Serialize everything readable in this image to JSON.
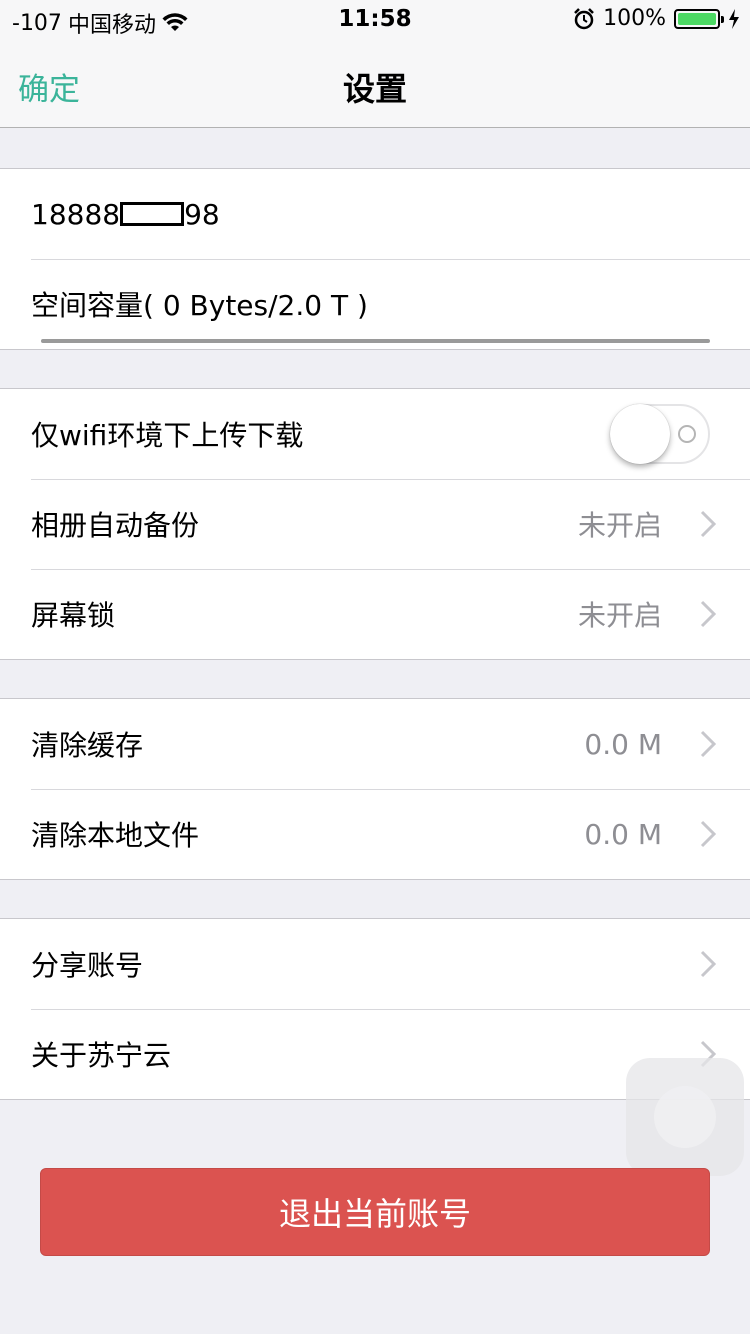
{
  "status_bar": {
    "signal": "-107",
    "carrier": "中国移动",
    "time": "11:58",
    "battery": "100%"
  },
  "nav": {
    "confirm_label": "确定",
    "title": "设置"
  },
  "account": {
    "phone_prefix": "18888",
    "phone_suffix": "98",
    "capacity_label": "空间容量( 0 Bytes/2.0 T )",
    "capacity_used_fraction": 0
  },
  "settings": [
    {
      "label": "仅wifi环境下上传下载",
      "toggle_on": false
    },
    {
      "label": "相册自动备份",
      "value": "未开启"
    },
    {
      "label": "屏幕锁",
      "value": "未开启"
    }
  ],
  "cache": [
    {
      "label": "清除缓存",
      "value": "0.0 M"
    },
    {
      "label": "清除本地文件",
      "value": "0.0 M"
    }
  ],
  "about": [
    {
      "label": "分享账号"
    },
    {
      "label": "关于苏宁云"
    }
  ],
  "logout_label": "退出当前账号",
  "colors": {
    "accent": "#3bb49a",
    "danger": "#db5350",
    "background": "#efeff4",
    "battery": "#4cd964"
  }
}
